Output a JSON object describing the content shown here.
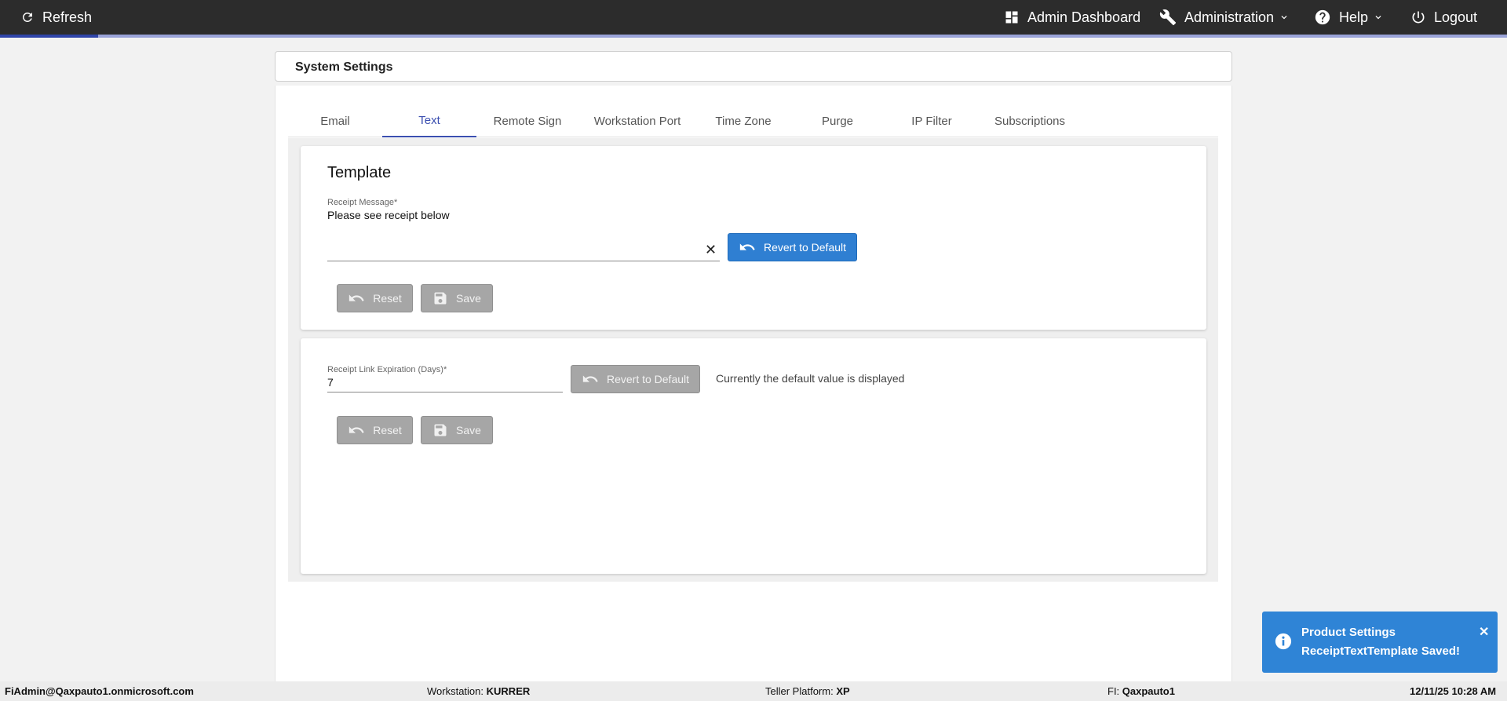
{
  "topbar": {
    "refresh_label": "Refresh",
    "admin_dashboard_label": "Admin Dashboard",
    "administration_label": "Administration",
    "help_label": "Help",
    "logout_label": "Logout",
    "progress_fraction": 0.065
  },
  "page": {
    "title": "System Settings"
  },
  "tabs": [
    {
      "label": "Email",
      "active": false
    },
    {
      "label": "Text",
      "active": true
    },
    {
      "label": "Remote Sign",
      "active": false
    },
    {
      "label": "Workstation Port",
      "active": false
    },
    {
      "label": "Time Zone",
      "active": false
    },
    {
      "label": "Purge",
      "active": false
    },
    {
      "label": "IP Filter",
      "active": false
    },
    {
      "label": "Subscriptions",
      "active": false
    }
  ],
  "template_section": {
    "title": "Template",
    "receipt_message_label": "Receipt Message*",
    "receipt_message_value": "Please see receipt below",
    "clear_symbol": "✕",
    "revert_label": "Revert to Default",
    "reset_label": "Reset",
    "save_label": "Save"
  },
  "expiration_section": {
    "label": "Receipt Link Expiration (Days)*",
    "value": "7",
    "revert_label": "Revert to Default",
    "note": "Currently the default value is displayed",
    "reset_label": "Reset",
    "save_label": "Save"
  },
  "toast": {
    "title": "Product Settings",
    "message": "ReceiptTextTemplate Saved!",
    "close_symbol": "✕",
    "color": "#2f84d6"
  },
  "statusbar": {
    "user": "FiAdmin@Qaxpauto1.onmicrosoft.com",
    "workstation_label": "Workstation:",
    "workstation_value": "KURRER",
    "teller_label": "Teller Platform:",
    "teller_value": "XP",
    "fi_label": "FI:",
    "fi_value": "Qaxpauto1",
    "datetime": "12/11/25 10:28 AM"
  },
  "colors": {
    "topbar": "#2c2c2c",
    "accent": "#3b4fb0",
    "primary_button": "#2f7fd2",
    "disabled_button": "#a6a6a6"
  }
}
